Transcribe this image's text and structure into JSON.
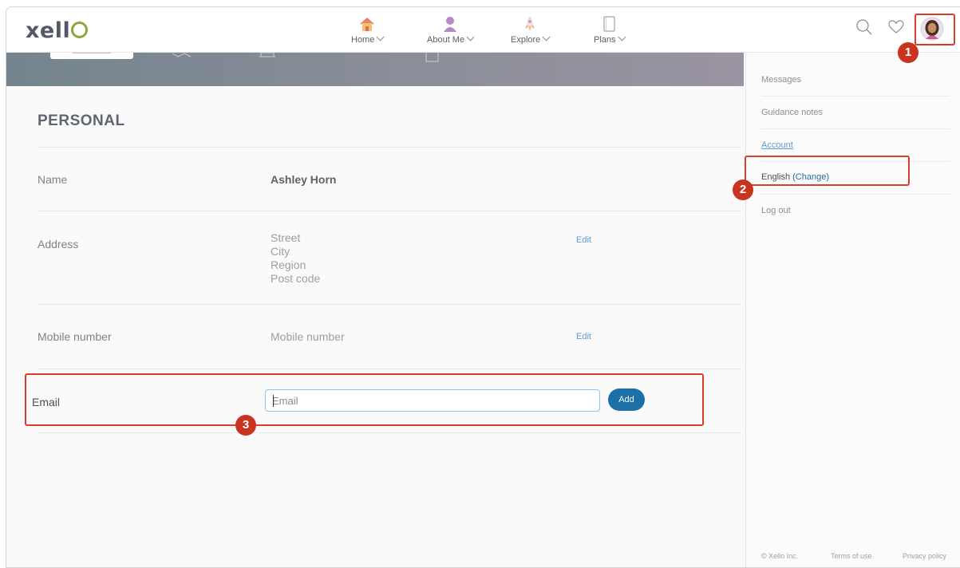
{
  "app": {
    "logo_text": "xello"
  },
  "nav": {
    "items": [
      {
        "label": "Home",
        "icon": "house-icon"
      },
      {
        "label": "About Me",
        "icon": "person-icon"
      },
      {
        "label": "Explore",
        "icon": "rocket-icon"
      },
      {
        "label": "Plans",
        "icon": "notebook-icon"
      }
    ],
    "right_icons": [
      "search-icon",
      "heart-icon",
      "avatar"
    ]
  },
  "profile": {
    "section_title": "PERSONAL",
    "name": {
      "label": "Name",
      "value": "Ashley Horn"
    },
    "address": {
      "label": "Address",
      "lines": [
        "Street",
        "City",
        "Region",
        "Post code"
      ],
      "edit_label": "Edit"
    },
    "mobile": {
      "label": "Mobile number",
      "value": "Mobile number",
      "edit_label": "Edit"
    },
    "email": {
      "label": "Email",
      "placeholder": "Email",
      "value": "",
      "add_label": "Add"
    }
  },
  "dropdown": {
    "items": [
      "Messages",
      "Guidance notes",
      "Account",
      "Log out"
    ],
    "language": "English",
    "change_label": "(Change)"
  },
  "footer": {
    "copyright": "© Xello Inc.",
    "terms": "Terms of use",
    "privacy": "Privacy policy"
  },
  "annotations": [
    "1",
    "2",
    "3"
  ],
  "colors": {
    "accent": "#1d6fa8",
    "highlight": "#d93d2c",
    "badge": "#c8341f",
    "link": "#5a9bd5"
  }
}
